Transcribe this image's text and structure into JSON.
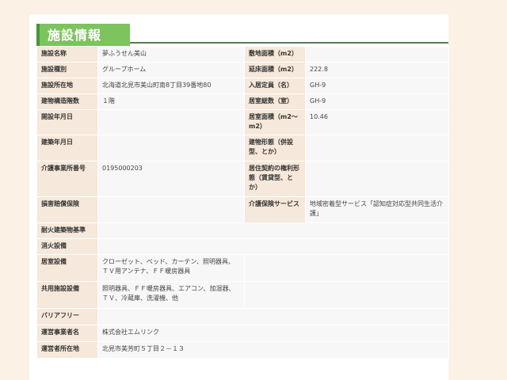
{
  "section_title": "施設情報",
  "rows": {
    "name_label": "施設名称",
    "name_value": "夢ふうせん美山",
    "site_area_label": "敷地面積（m2）",
    "site_area_value": "",
    "type_label": "施設種別",
    "type_value": "グループホーム",
    "floor_area_label": "延床面積（m2）",
    "floor_area_value": "222.8",
    "address_label": "施設所在地",
    "address_value": "北海道北見市美山町南8丁目39番地80",
    "capacity_label": "入居定員（名）",
    "capacity_value": "GH-9",
    "floors_label": "建物構造階数",
    "floors_value": "１階",
    "rooms_label": "居室総数（室）",
    "rooms_value": "GH-9",
    "opened_label": "開設年月日",
    "opened_value": "",
    "room_area_label": "居室面積（m2～m2）",
    "room_area_value": "10.46",
    "built_label": "建築年月日",
    "built_value": "",
    "building_form_label": "建物形態（併設型、とか）",
    "building_form_value": "",
    "office_no_label": "介護事業所番号",
    "office_no_value": "0195000203",
    "contract_label": "居住契約の権利形態（賃貸型、とか）",
    "contract_value": "",
    "insurance_label": "損害賠償保険",
    "insurance_value": "",
    "care_service_label": "介護保険サービス",
    "care_service_value": "地域密着型サービス「認知症対応型共同生活介護」",
    "fireproof_label": "耐火建築物基準",
    "fireproof_value": "",
    "firefighting_label": "消火設備",
    "firefighting_value": "",
    "room_equipment_label": "居室設備",
    "room_equipment_value": "クローゼット、ベッド、カーテン、照明器具、ＴＶ用アンテナ、ＦＦ暖房器具",
    "shared_equipment_label": "共用施設設備",
    "shared_equipment_value": "照明器具、ＦＦ暖房器具、エアコン、加湿器、ＴＶ、冷蔵庫、洗濯機、他",
    "barrier_free_label": "バリアフリー",
    "barrier_free_value": "",
    "operator_label": "運営事業者名",
    "operator_value": "株式会社エムリンク",
    "operator_address_label": "運営者所在地",
    "operator_address_value": "北見市美芳町５丁目２－１３"
  }
}
